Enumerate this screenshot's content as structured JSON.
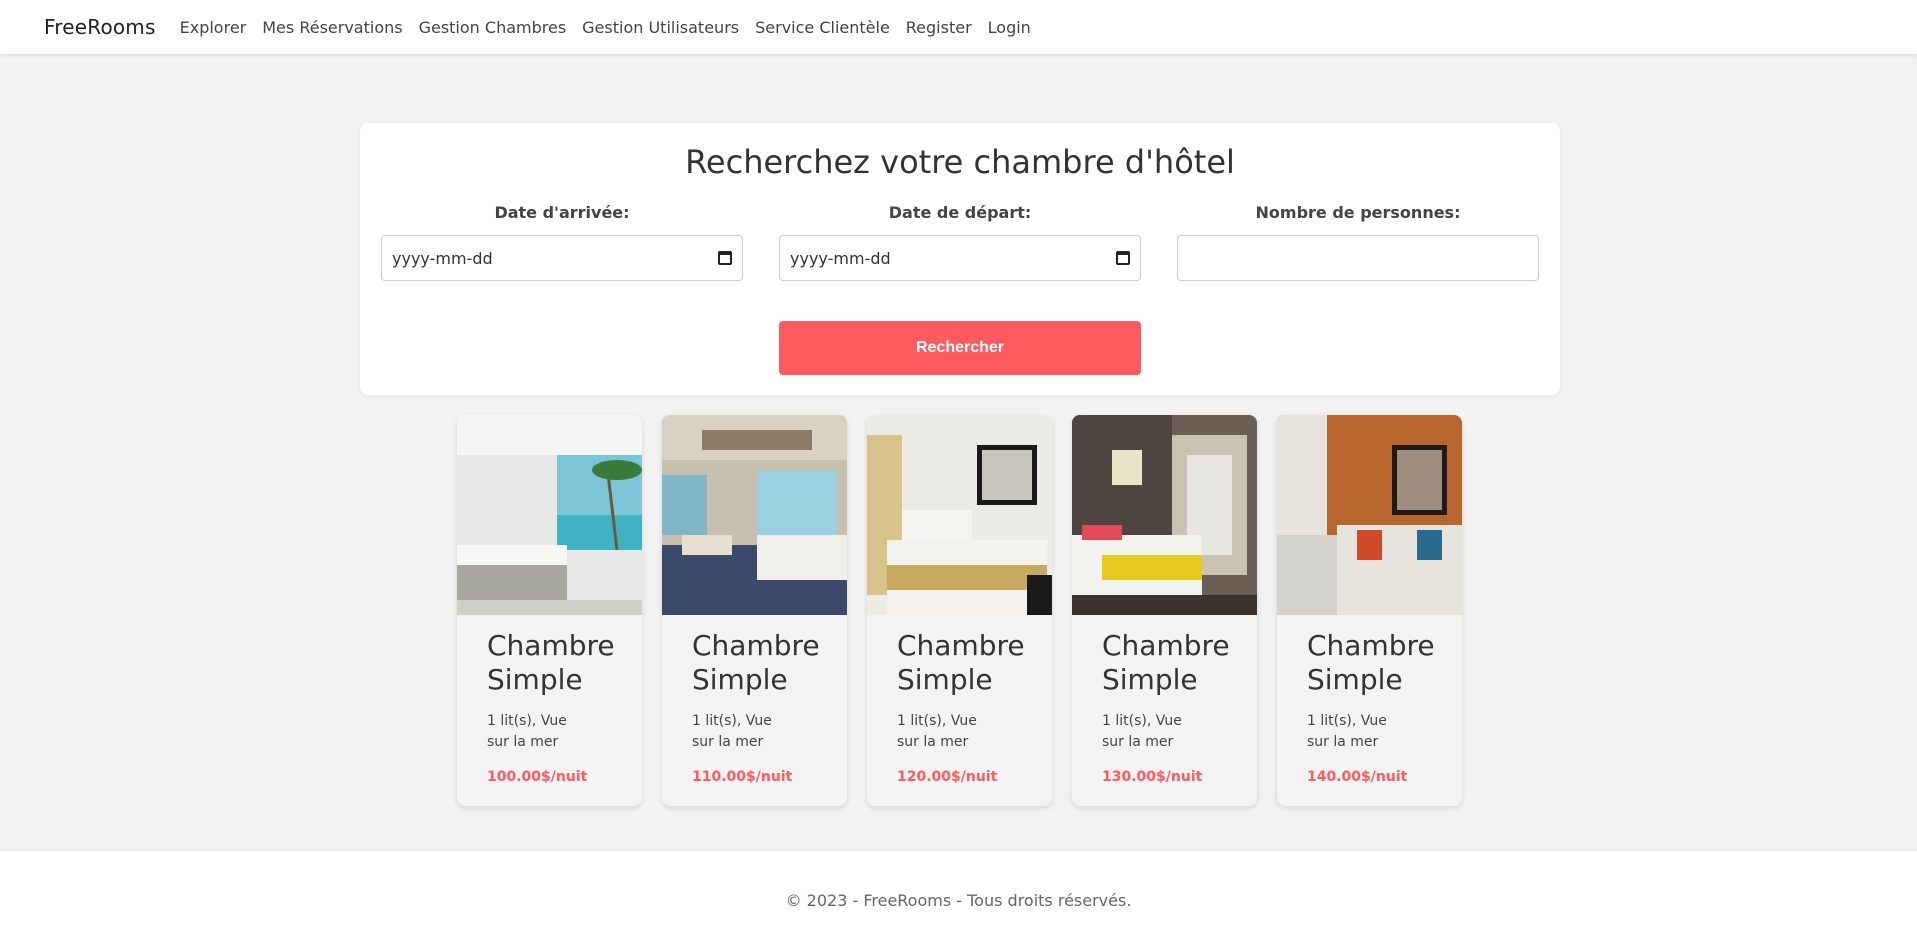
{
  "navbar": {
    "brand": "FreeRooms",
    "links": [
      "Explorer",
      "Mes Réservations",
      "Gestion Chambres",
      "Gestion Utilisateurs",
      "Service Clientèle",
      "Register",
      "Login"
    ]
  },
  "search": {
    "title": "Recherchez votre chambre d'hôtel",
    "arrival_label": "Date d'arrivée:",
    "arrival_value": "yyyy-mm-dd",
    "departure_label": "Date de départ:",
    "departure_value": "yyyy-mm-dd",
    "persons_label": "Nombre de personnes:",
    "persons_value": "",
    "button_label": "Rechercher"
  },
  "rooms": [
    {
      "title": "Chambre Simple",
      "desc": "1 lit(s), Vue sur la mer",
      "price": "100.00$/nuit"
    },
    {
      "title": "Chambre Simple",
      "desc": "1 lit(s), Vue sur la mer",
      "price": "110.00$/nuit"
    },
    {
      "title": "Chambre Simple",
      "desc": "1 lit(s), Vue sur la mer",
      "price": "120.00$/nuit"
    },
    {
      "title": "Chambre Simple",
      "desc": "1 lit(s), Vue sur la mer",
      "price": "130.00$/nuit"
    },
    {
      "title": "Chambre Simple",
      "desc": "1 lit(s), Vue sur la mer",
      "price": "140.00$/nuit"
    }
  ],
  "footer": {
    "text": "© 2023 - FreeRooms - Tous droits réservés."
  },
  "colors": {
    "accent": "#ff5a5f",
    "background": "#f2f2f2"
  }
}
